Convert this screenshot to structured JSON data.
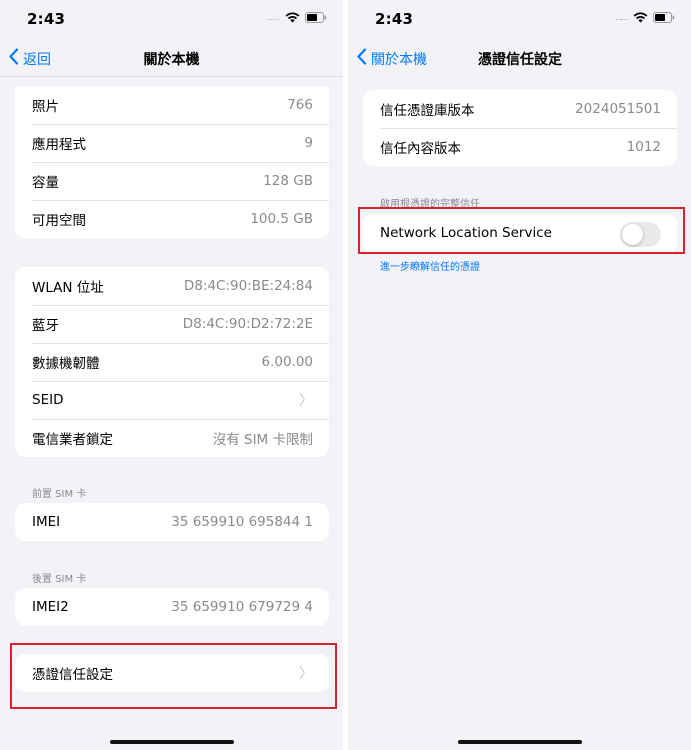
{
  "status_bar": {
    "time": "2:43",
    "signal": "....."
  },
  "left": {
    "nav": {
      "back_label": "返回",
      "title": "關於本機"
    },
    "group1": [
      {
        "label": "照片",
        "value": "766"
      },
      {
        "label": "應用程式",
        "value": "9"
      },
      {
        "label": "容量",
        "value": "128 GB"
      },
      {
        "label": "可用空間",
        "value": "100.5 GB"
      }
    ],
    "group2": [
      {
        "label": "WLAN 位址",
        "value": "D8:4C:90:BE:24:84"
      },
      {
        "label": "藍牙",
        "value": "D8:4C:90:D2:72:2E"
      },
      {
        "label": "數據機韌體",
        "value": "6.00.00"
      },
      {
        "label": "SEID",
        "value": ""
      },
      {
        "label": "電信業者鎖定",
        "value": "沒有 SIM 卡限制"
      }
    ],
    "front_sim": {
      "header": "前置 SIM 卡",
      "label": "IMEI",
      "value": "35 659910 695844 1"
    },
    "rear_sim": {
      "header": "後置 SIM 卡",
      "label": "IMEI2",
      "value": "35 659910 679729 4"
    },
    "cert_trust": {
      "label": "憑證信任設定"
    }
  },
  "right": {
    "nav": {
      "back_label": "關於本機",
      "title": "憑證信任設定"
    },
    "versions": [
      {
        "label": "信任憑證庫版本",
        "value": "2024051501"
      },
      {
        "label": "信任內容版本",
        "value": "1012"
      }
    ],
    "full_trust": {
      "header": "啟用根憑證的完整信任",
      "items": [
        {
          "label": "Network Location Service",
          "enabled": false
        }
      ],
      "learn_more": "進一步瞭解信任的憑證"
    }
  },
  "colors": {
    "accent": "#007aff",
    "highlight": "#d9202e",
    "background": "#f2f2f7"
  }
}
